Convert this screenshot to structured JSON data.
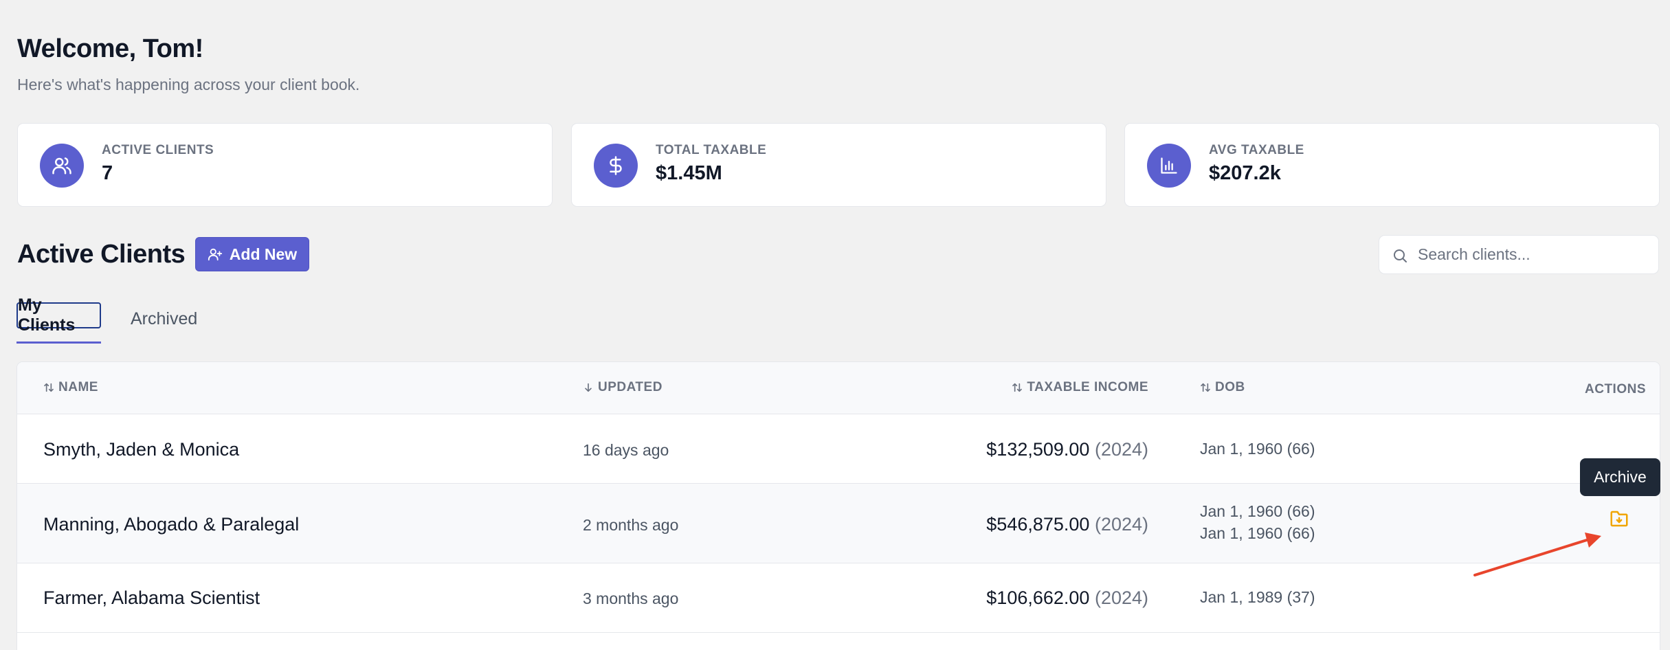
{
  "header": {
    "welcome": "Welcome, Tom!",
    "subtitle": "Here's what's happening across your client book."
  },
  "stats": [
    {
      "label": "ACTIVE CLIENTS",
      "value": "7",
      "icon": "users-icon"
    },
    {
      "label": "TOTAL TAXABLE",
      "value": "$1.45M",
      "icon": "dollar-icon"
    },
    {
      "label": "AVG TAXABLE",
      "value": "$207.2k",
      "icon": "bar-chart-icon"
    }
  ],
  "section": {
    "title": "Active Clients",
    "add_button": "Add New"
  },
  "search": {
    "placeholder": "Search clients..."
  },
  "tabs": [
    {
      "label": "My Clients",
      "active": true
    },
    {
      "label": "Archived",
      "active": false
    }
  ],
  "table": {
    "columns": {
      "name": "NAME",
      "updated": "UPDATED",
      "income": "TAXABLE INCOME",
      "dob": "DOB",
      "actions": "ACTIONS"
    },
    "rows": [
      {
        "name": "Smyth, Jaden & Monica",
        "updated": "16 days ago",
        "income": "$132,509.00",
        "year": "(2024)",
        "dob1": "Jan 1, 1960 (66)",
        "dob2": ""
      },
      {
        "name": "Manning, Abogado & Paralegal",
        "updated": "2 months ago",
        "income": "$546,875.00",
        "year": "(2024)",
        "dob1": "Jan 1, 1960 (66)",
        "dob2": "Jan 1, 1960 (66)"
      },
      {
        "name": "Farmer, Alabama Scientist",
        "updated": "3 months ago",
        "income": "$106,662.00",
        "year": "(2024)",
        "dob1": "Jan 1, 1989 (37)",
        "dob2": ""
      }
    ]
  },
  "tooltip": {
    "text": "Archive"
  },
  "colors": {
    "accent": "#5b5fcf",
    "archive_icon": "#f0a500",
    "annotation_arrow": "#e8452c"
  }
}
